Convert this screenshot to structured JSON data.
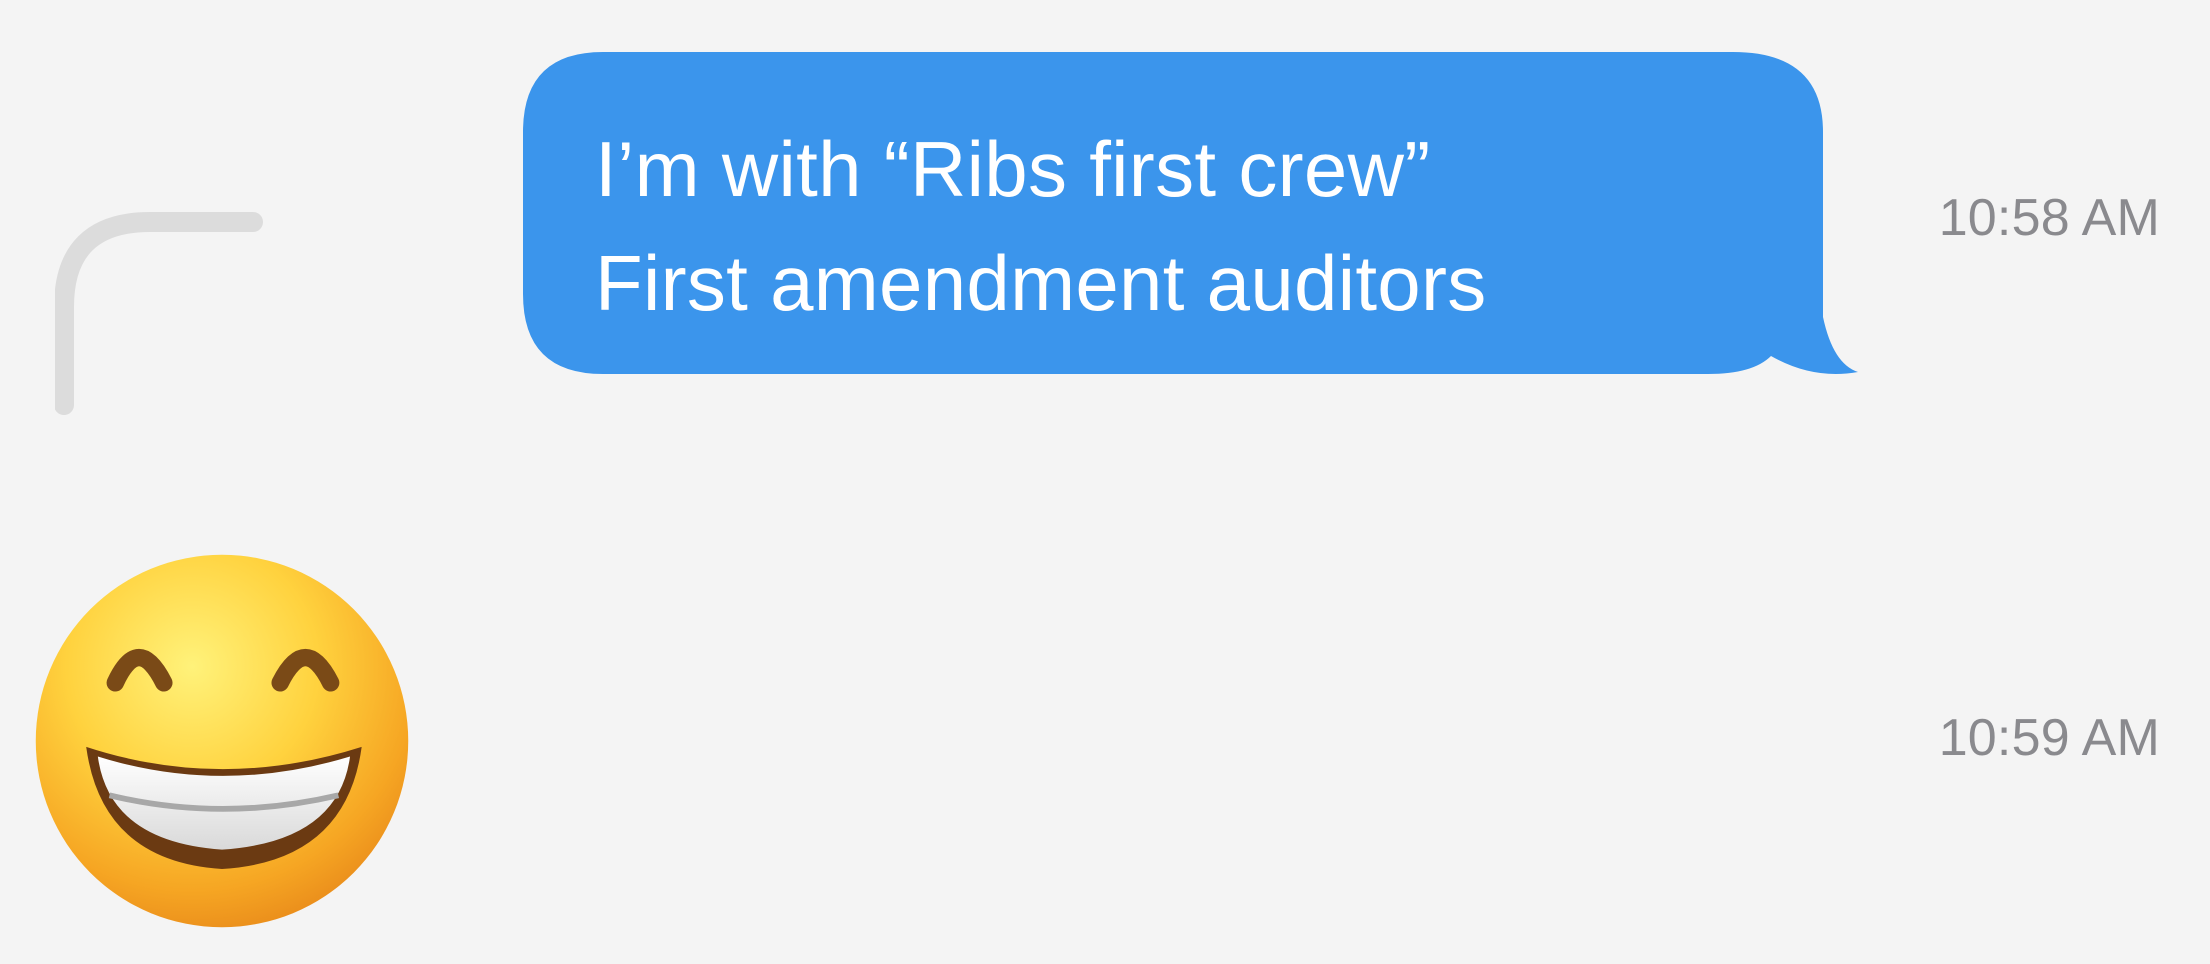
{
  "conversation": {
    "messages": [
      {
        "kind": "text",
        "direction": "outgoing",
        "lines": [
          "I’m with “Ribs first crew”",
          "First amendment auditors"
        ],
        "time": "10:58 AM"
      },
      {
        "kind": "emoji",
        "direction": "outgoing",
        "emoji": "grinning-face-with-smiling-eyes",
        "time": "10:59 AM"
      }
    ]
  },
  "icons": {
    "reply_indicator": "reply-arc-icon",
    "emoji": "beaming-face-icon"
  },
  "colors": {
    "background": "#f4f4f4",
    "bubble": "#3b95ec",
    "bubble_text": "#ffffff",
    "timestamp": "#8a8a8e",
    "reply_arc": "#dcdcdc"
  }
}
